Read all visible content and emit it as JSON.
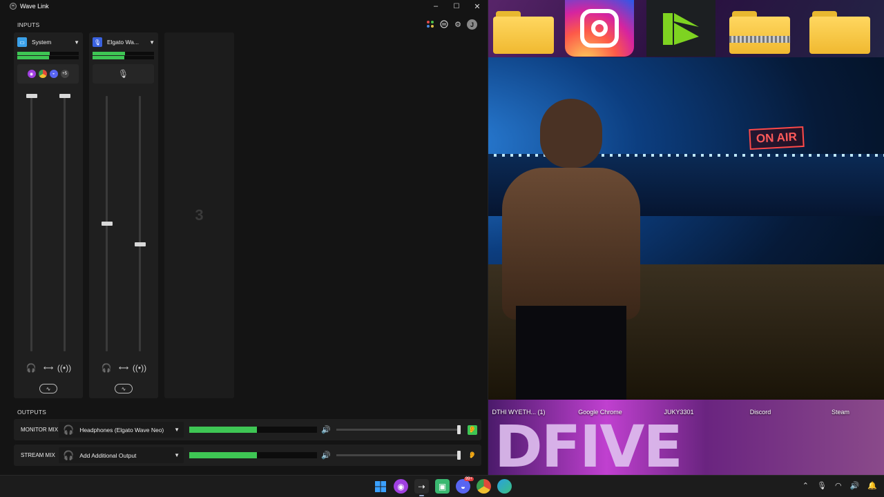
{
  "window": {
    "title": "Wave Link",
    "minimize": "–",
    "maximize": "☐",
    "close": "✕"
  },
  "inputs": {
    "section_label": "INPUTS",
    "channels": [
      {
        "name": "System",
        "color": "#3aa0e8",
        "meter_level": 0.53,
        "fader_monitor": 1.0,
        "fader_stream": 1.0
      },
      {
        "name": "Elgato Wa...",
        "color": "#3a62e0",
        "meter_level": 0.53,
        "fader_monitor": 0.5,
        "fader_stream": 0.42
      }
    ],
    "empty_slot_number": "3",
    "system_apps_more": "+5"
  },
  "outputs": {
    "section_label": "OUTPUTS",
    "rows": [
      {
        "label": "MONITOR MIX",
        "device": "Headphones (Elgato Wave Neo)",
        "meter_level": 0.53,
        "volume": 1.0,
        "monitoring": true
      },
      {
        "label": "STREAM MIX",
        "device": "Add Additional Output",
        "meter_level": 0.53,
        "volume": 1.0,
        "monitoring": false
      }
    ]
  },
  "header_icons": [
    "apps-icon",
    "marketplace-icon",
    "settings-icon"
  ],
  "user_avatar": "J",
  "colors": {
    "accent_green": "#3ec654",
    "panel": "#1f1f1f",
    "window_bg": "#141414"
  },
  "desktop": {
    "shortcuts": [
      {
        "label": "DTHI WYETH... (1)"
      },
      {
        "label": "Google Chrome"
      },
      {
        "label": "JUKY3301"
      },
      {
        "label": "Discord"
      },
      {
        "label": "Steam"
      }
    ],
    "art_text": "DFIVE",
    "webcam_sign": "ON AIR"
  },
  "taskbar": {
    "discord_badge": "99+"
  }
}
